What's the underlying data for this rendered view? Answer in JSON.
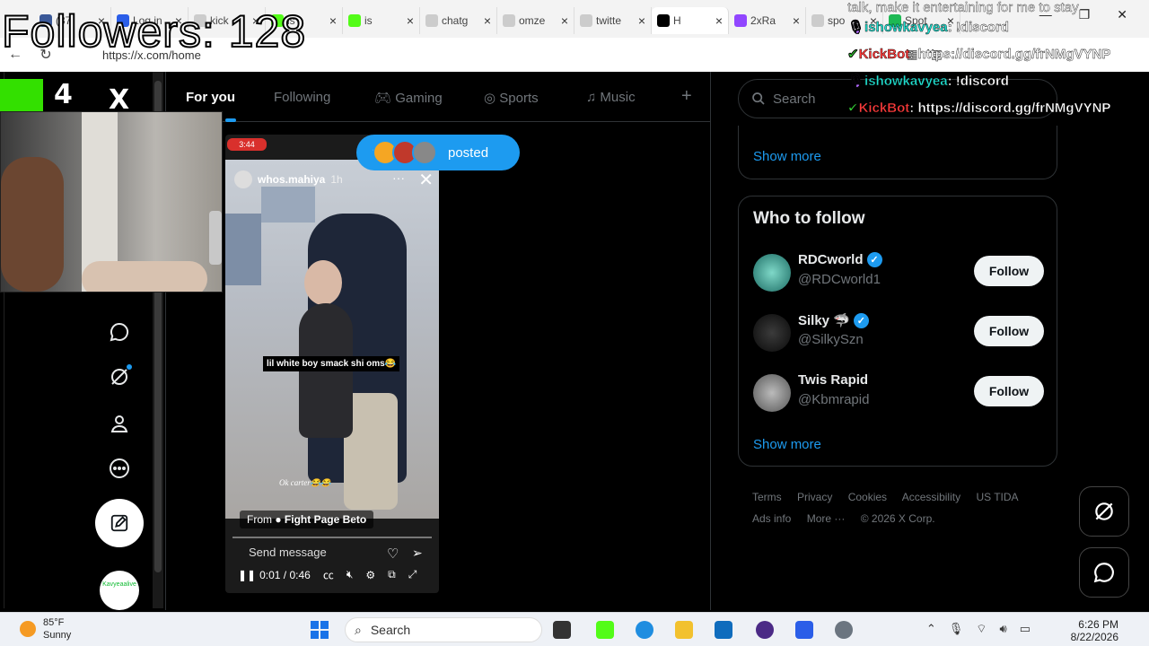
{
  "browser": {
    "tabs": [
      {
        "label": "(37)",
        "color": "#3b5998"
      },
      {
        "label": "Log in",
        "color": "#2b5ee8"
      },
      {
        "label": "kick",
        "color": "#cccccc"
      },
      {
        "label": "is",
        "color": "#53fc18"
      },
      {
        "label": "is",
        "color": "#53fc18"
      },
      {
        "label": "chatg",
        "color": "#cccccc"
      },
      {
        "label": "omze",
        "color": "#cccccc"
      },
      {
        "label": "twitte",
        "color": "#cccccc"
      },
      {
        "label": "H",
        "color": "#000000"
      },
      {
        "label": "2xRa",
        "color": "#9146ff"
      },
      {
        "label": "spo",
        "color": "#cccccc"
      },
      {
        "label": "Spot",
        "color": "#1db954"
      }
    ],
    "url": "https://x.com/home"
  },
  "overlay": {
    "followers": "Followers: 128",
    "badge_number": "4",
    "chat": [
      {
        "user": "ishowkavyea",
        "message": "!discord"
      },
      {
        "user": "KickBot",
        "message": "https://discord.gg/frNMgVYNP"
      },
      {
        "user": "ishowkavyea",
        "message": "!discord"
      },
      {
        "user": "KickBot",
        "message": "https://discord.gg/frNMgVYNP"
      }
    ],
    "chat_top_fragment": "talk, make it entertaining for me to stay"
  },
  "x": {
    "logo": "X",
    "tabs": [
      "For you",
      "Following",
      "Gaming",
      "Sports",
      "Music"
    ],
    "active_tab": "For you",
    "posted_pill": "posted",
    "search_placeholder": "Search",
    "show_more_top": "Show more",
    "who_to_follow": {
      "title": "Who to follow",
      "accounts": [
        {
          "name": "RDCworld",
          "handle": "@RDCworld1",
          "verified": true,
          "button": "Follow"
        },
        {
          "name": "Silky 🦈",
          "handle": "@SilkySzn",
          "verified": true,
          "button": "Follow"
        },
        {
          "name": "Twis Rapid",
          "handle": "@Kbmrapid",
          "verified": false,
          "button": "Follow"
        }
      ],
      "show_more": "Show more"
    },
    "footer": [
      "Terms",
      "Privacy",
      "Cookies",
      "Accessibility",
      "US TIDA",
      "Ads info",
      "More ···",
      "© 2026 X Corp."
    ],
    "nav_avatar_text": "Kavyeaalive"
  },
  "video": {
    "badge": "3:44",
    "user": "whos.mahiya",
    "time": "1h",
    "caption": "lil white boy smack shi oms😂",
    "caption2": "Ok carter😂😂",
    "from_prefix": "From",
    "from_name": "Fight Page Beto",
    "send_placeholder": "Send message",
    "timecode": "0:01 / 0:46"
  },
  "taskbar": {
    "temp": "85°F",
    "condition": "Sunny",
    "search": "Search",
    "time": "6:26 PM",
    "date": "8/22/2026"
  }
}
